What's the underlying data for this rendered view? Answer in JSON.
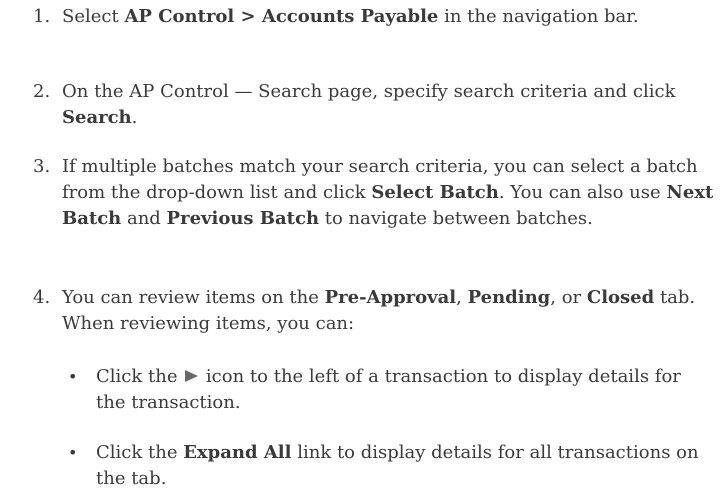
{
  "steps": [
    {
      "number": "1.",
      "parts": [
        "Select ",
        "AP Control > Accounts Payable",
        " in the navigation bar."
      ]
    },
    {
      "number": "2.",
      "parts": [
        "On the AP Control — Search page, specify search criteria and click ",
        "Search",
        "."
      ]
    },
    {
      "number": "3.",
      "parts": [
        "If multiple batches match your search criteria, you can select a batch from the drop-down list and click ",
        "Select Batch",
        ". You can also use ",
        "Next Batch",
        " and ",
        "Previous Batch",
        " to navigate between batches."
      ]
    },
    {
      "number": "4.",
      "parts": [
        "You can review items on the ",
        "Pre-Approval",
        ", ",
        "Pending",
        ", or ",
        "Closed",
        " tab. When reviewing items, you can:"
      ]
    }
  ],
  "bullets": [
    {
      "symbol": "•",
      "before": "Click the ",
      "icon": "expand-triangle-icon",
      "after": " icon to the left of a transaction to display details for the transaction."
    },
    {
      "symbol": "•",
      "parts": [
        "Click the ",
        "Expand All",
        " link to display details for all transactions on the tab."
      ]
    }
  ]
}
